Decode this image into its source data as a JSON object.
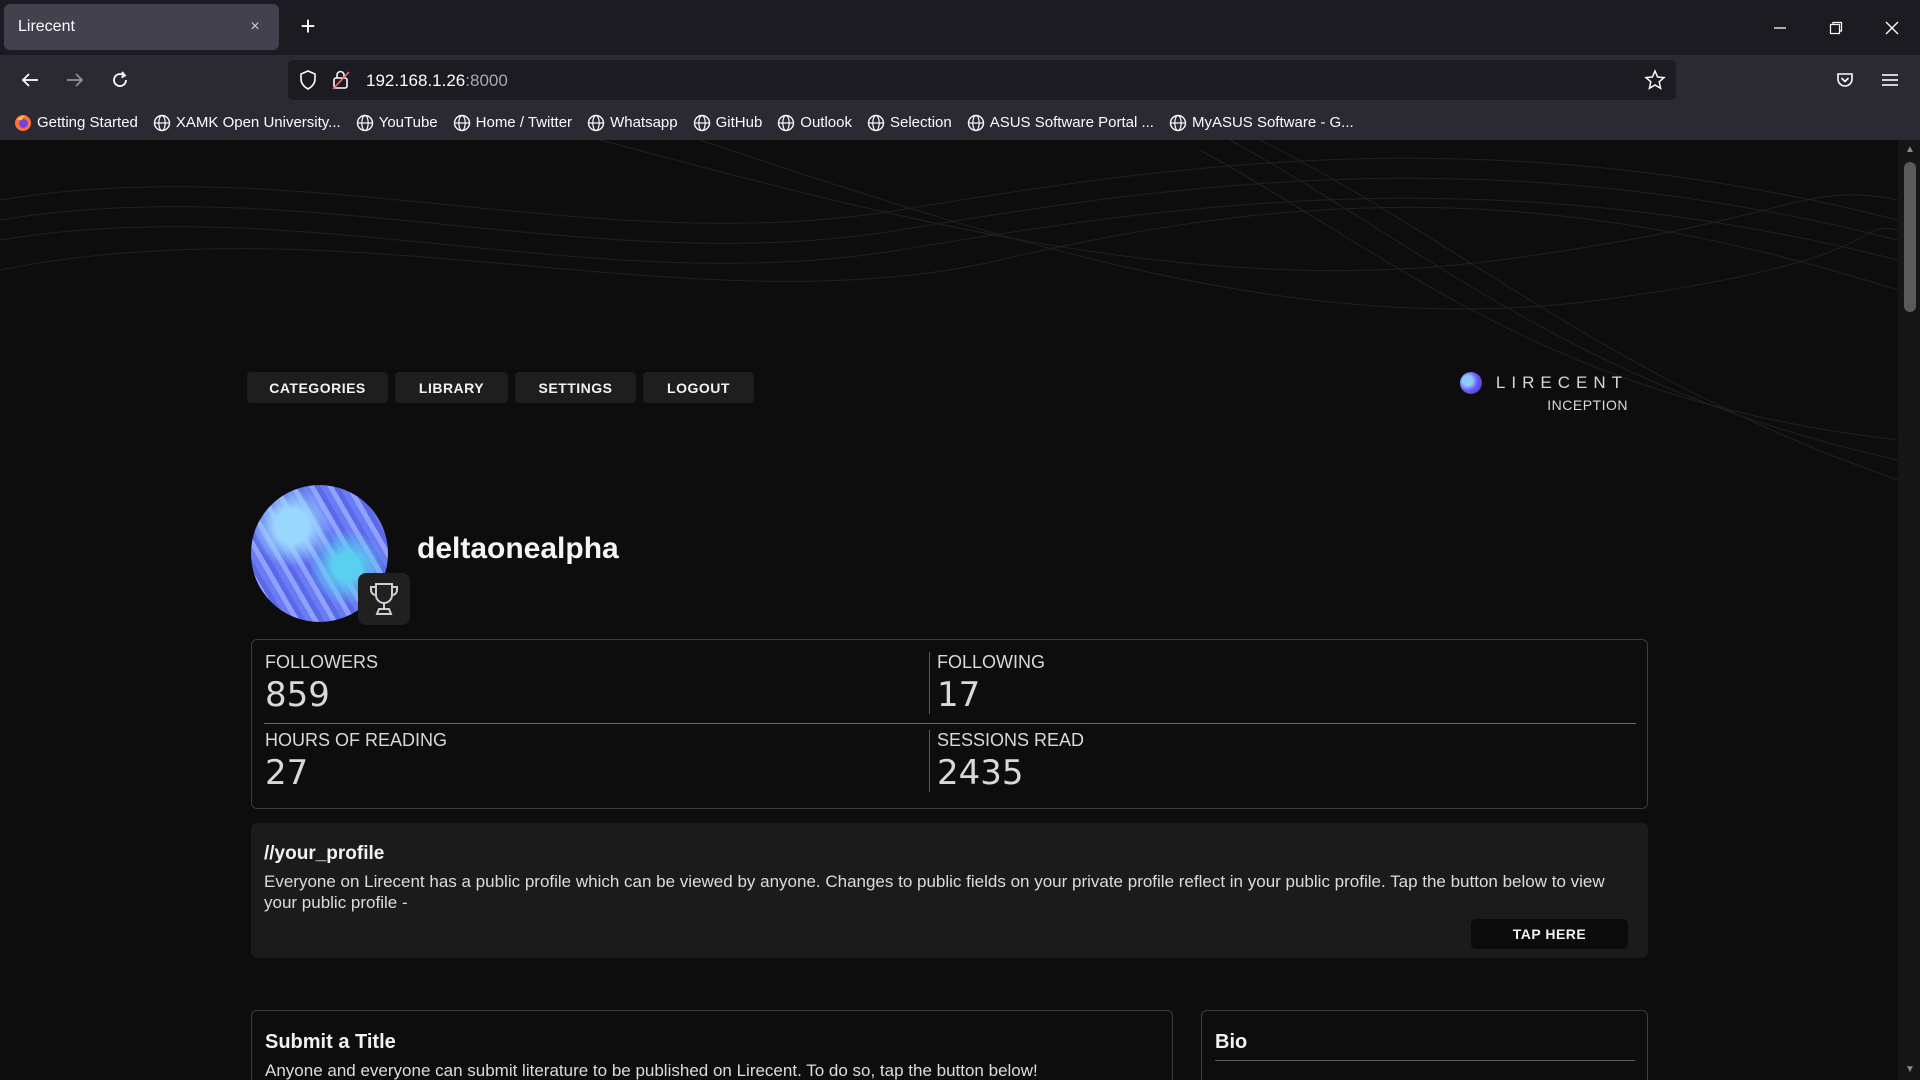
{
  "browser": {
    "tab_title": "Lirecent",
    "tab_close": "×",
    "new_tab": "+",
    "url_host": "192.168.1.26",
    "url_port": ":8000",
    "bookmarks": [
      {
        "label": "Getting Started",
        "icon": "firefox-icon"
      },
      {
        "label": "XAMK Open University...",
        "icon": "globe-icon"
      },
      {
        "label": "YouTube",
        "icon": "globe-icon"
      },
      {
        "label": "Home / Twitter",
        "icon": "globe-icon"
      },
      {
        "label": "Whatsapp",
        "icon": "globe-icon"
      },
      {
        "label": "GitHub",
        "icon": "globe-icon"
      },
      {
        "label": "Outlook",
        "icon": "globe-icon"
      },
      {
        "label": "Selection",
        "icon": "globe-icon"
      },
      {
        "label": "ASUS Software Portal ...",
        "icon": "globe-icon"
      },
      {
        "label": "MyASUS Software - G...",
        "icon": "globe-icon"
      }
    ]
  },
  "menu": {
    "items": [
      {
        "label": "CATEGORIES"
      },
      {
        "label": "LIBRARY"
      },
      {
        "label": "SETTINGS"
      },
      {
        "label": "LOGOUT"
      }
    ]
  },
  "brand": {
    "name": "LIRECENT",
    "subtitle": "INCEPTION"
  },
  "profile": {
    "username": "deltaonealpha",
    "badge_icon": "trophy-icon"
  },
  "stats": {
    "followers_label": "FOLLOWERS",
    "followers_value": "859",
    "following_label": "FOLLOWING",
    "following_value": "17",
    "hours_label": "HOURS OF READING",
    "hours_value": "27",
    "sessions_label": "SESSIONS READ",
    "sessions_value": "2435"
  },
  "your_profile": {
    "title": "//your_profile",
    "text": "Everyone on Lirecent has a public profile which can be viewed by anyone. Changes to public fields on your private profile reflect in your public profile. Tap the button below to view your public profile -",
    "button_label": "TAP HERE"
  },
  "submit": {
    "title": "Submit a Title",
    "text": "Anyone and everyone can submit literature to be published on Lirecent. To do so, tap the button below!"
  },
  "bio": {
    "title": "Bio"
  },
  "colors": {
    "page_bg": "#0d0d0d",
    "card_bg": "#1b1b1b",
    "chrome_bg": "#2b2a33",
    "accent": "#6b5cff"
  }
}
